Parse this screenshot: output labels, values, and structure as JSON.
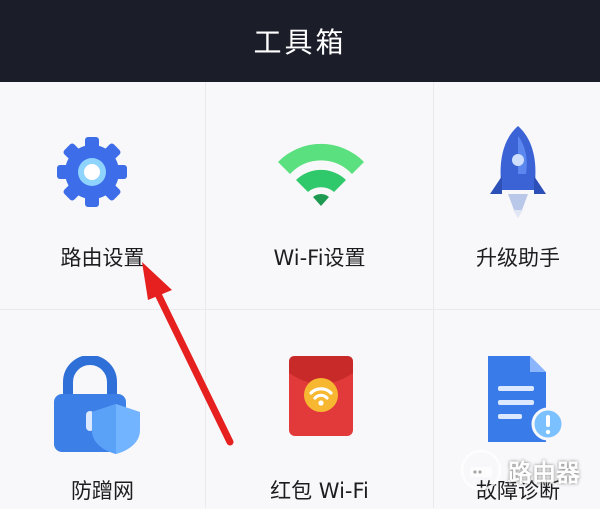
{
  "header": {
    "title": "工具箱"
  },
  "tools": [
    {
      "label": "路由设置",
      "icon": "gear-icon"
    },
    {
      "label": "Wi-Fi设置",
      "icon": "wifi-icon"
    },
    {
      "label": "升级助手",
      "icon": "rocket-icon"
    },
    {
      "label": "防蹭网",
      "icon": "lock-shield-icon"
    },
    {
      "label": "红包 Wi-Fi",
      "icon": "red-envelope-wifi-icon"
    },
    {
      "label": "故障诊断",
      "icon": "document-alert-icon"
    }
  ],
  "watermark": {
    "text": "路由器"
  },
  "colors": {
    "header_bg": "#1b1e29",
    "gear_blue": "#3d6de8",
    "wifi_green": "#2fc86a",
    "rocket_blue": "#3b63d6",
    "lock_blue": "#3c7fe6",
    "envelope_red": "#e23a3a",
    "envelope_coin": "#f7b731",
    "doc_blue": "#3a7bea",
    "arrow_red": "#e5201f"
  }
}
